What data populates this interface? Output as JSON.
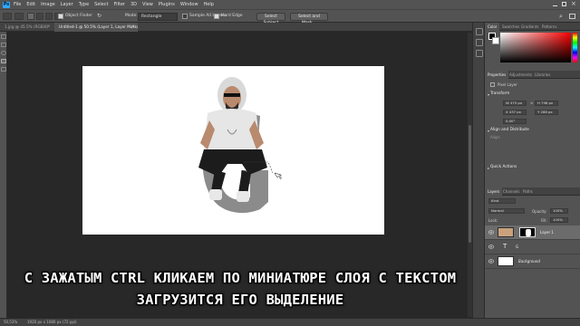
{
  "menubar": {
    "items": [
      "File",
      "Edit",
      "Image",
      "Layer",
      "Type",
      "Select",
      "Filter",
      "3D",
      "View",
      "Plugins",
      "Window",
      "Help"
    ]
  },
  "options": {
    "object_finder": "Object Finder",
    "mode_label": "Mode:",
    "mode_value": "Rectangle",
    "sample_all_layers": "Sample All Layers",
    "hard_edge": "Hard Edge",
    "select_subject": "Select Subject",
    "select_and_mask": "Select and Mask..."
  },
  "tabs": [
    {
      "label": "1.jpg @ 45.5% (RGB/8)",
      "active": false
    },
    {
      "label": "Untitled-1 @ 50.5% (Layer 1, Layer Mask/8) *",
      "active": true
    }
  ],
  "panels": {
    "top_tabs": [
      "Color",
      "Swatches",
      "Gradients",
      "Patterns"
    ],
    "props_tabs": [
      "Properties",
      "Adjustments",
      "Libraries"
    ],
    "pixel_layer": "Pixel Layer",
    "transform_title": "Transform",
    "transform": {
      "w": "W 475 px",
      "h": "H 798 px",
      "x": "X 437 px",
      "y": "Y 288 px",
      "angle": "0,00°"
    },
    "align_title": "Align and Distribute",
    "align_sub": "Align:",
    "quick_actions": "Quick Actions",
    "layers_tabs": [
      "Layers",
      "Channels",
      "Paths"
    ],
    "kind": "Kind",
    "blend_mode": "Normal",
    "opacity_label": "Opacity:",
    "opacity_value": "100%",
    "lock_label": "Lock:",
    "fill_label": "Fill:",
    "fill_value": "100%",
    "layers": [
      {
        "name": "Layer 1",
        "type": "pixel-mask",
        "selected": true
      },
      {
        "name": "G",
        "type": "text",
        "selected": false
      },
      {
        "name": "Background",
        "type": "background",
        "selected": false
      }
    ]
  },
  "canvas": {
    "letter": "G"
  },
  "statusbar": {
    "zoom": "50,53%",
    "doc_info": "1920 px x 1080 px (72 ppi)"
  },
  "subtitles": {
    "line1": "С ЗАЖАТЫМ CTRL КЛИКАЕМ ПО МИНИАТЮРЕ СЛОЯ С ТЕКСТОМ",
    "line2": "ЗАГРУЗИТСЯ ЕГО ВЫДЕЛЕНИЕ"
  }
}
